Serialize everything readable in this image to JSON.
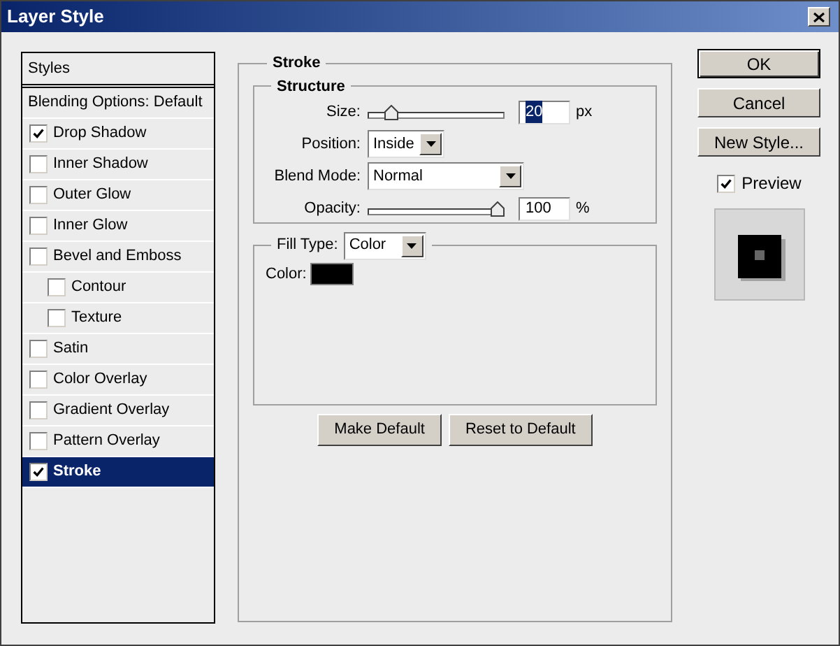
{
  "window": {
    "title": "Layer Style"
  },
  "styles_panel": {
    "header": "Styles",
    "items": [
      {
        "kind": "option",
        "label": "Blending Options: Default",
        "selected": false
      },
      {
        "kind": "effect",
        "label": "Drop Shadow",
        "checked": true,
        "selected": false
      },
      {
        "kind": "effect",
        "label": "Inner Shadow",
        "checked": false,
        "selected": false
      },
      {
        "kind": "effect",
        "label": "Outer Glow",
        "checked": false,
        "selected": false
      },
      {
        "kind": "effect",
        "label": "Inner Glow",
        "checked": false,
        "selected": false
      },
      {
        "kind": "effect",
        "label": "Bevel and Emboss",
        "checked": false,
        "selected": false,
        "children": [
          {
            "kind": "effect",
            "label": "Contour",
            "checked": false,
            "selected": false
          },
          {
            "kind": "effect",
            "label": "Texture",
            "checked": false,
            "selected": false
          }
        ]
      },
      {
        "kind": "effect",
        "label": "Satin",
        "checked": false,
        "selected": false
      },
      {
        "kind": "effect",
        "label": "Color Overlay",
        "checked": false,
        "selected": false
      },
      {
        "kind": "effect",
        "label": "Gradient Overlay",
        "checked": false,
        "selected": false
      },
      {
        "kind": "effect",
        "label": "Pattern Overlay",
        "checked": false,
        "selected": false
      },
      {
        "kind": "effect",
        "label": "Stroke",
        "checked": true,
        "selected": true
      }
    ]
  },
  "stroke": {
    "title": "Stroke",
    "structure": {
      "title": "Structure",
      "size": {
        "label": "Size:",
        "level": 0.14,
        "value": "20",
        "unit": "px"
      },
      "position": {
        "label": "Position:",
        "value": "Inside"
      },
      "blend_mode": {
        "label": "Blend Mode:",
        "value": "Normal"
      },
      "opacity": {
        "label": "Opacity:",
        "level": 1,
        "value": "100",
        "unit": "%"
      }
    },
    "fill": {
      "label": "Fill Type:",
      "value": "Color",
      "color_label": "Color:",
      "color": "#000000"
    },
    "buttons": [
      "Make Default",
      "Reset to Default"
    ]
  },
  "actions": [
    "OK",
    "Cancel",
    "New Style..."
  ],
  "preview": {
    "label": "Preview",
    "checked": true
  }
}
